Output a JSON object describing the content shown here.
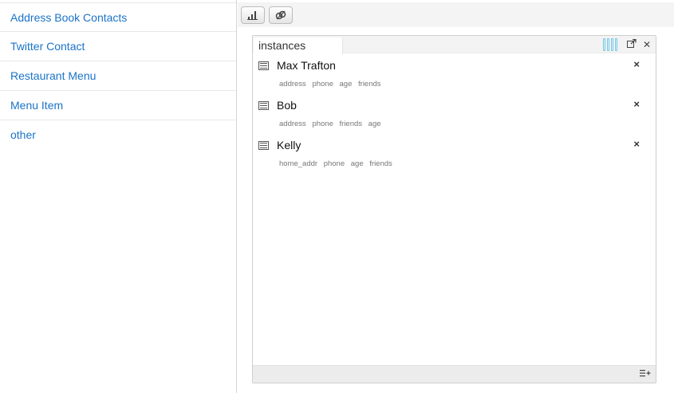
{
  "sidebar": {
    "items": [
      {
        "label": "Address Book Contacts"
      },
      {
        "label": "Twitter Contact"
      },
      {
        "label": "Restaurant Menu"
      },
      {
        "label": "Menu Item"
      },
      {
        "label": "other"
      }
    ]
  },
  "toolbar": {
    "buttons": [
      {
        "icon": "bar-chart-icon"
      },
      {
        "icon": "link-icon"
      }
    ]
  },
  "panel": {
    "tab_label": "instances",
    "header_icons": [
      "columns-icon",
      "popout-icon",
      "close-icon"
    ],
    "footer_icon": "add-list-icon",
    "instances": [
      {
        "name": "Max Trafton",
        "fields": [
          "address",
          "phone",
          "age",
          "friends"
        ]
      },
      {
        "name": "Bob",
        "fields": [
          "address",
          "phone",
          "friends",
          "age"
        ]
      },
      {
        "name": "Kelly",
        "fields": [
          "home_addr",
          "phone",
          "age",
          "friends"
        ]
      }
    ]
  },
  "colors": {
    "link": "#1a73c8",
    "accent": "#6fc6e6"
  }
}
